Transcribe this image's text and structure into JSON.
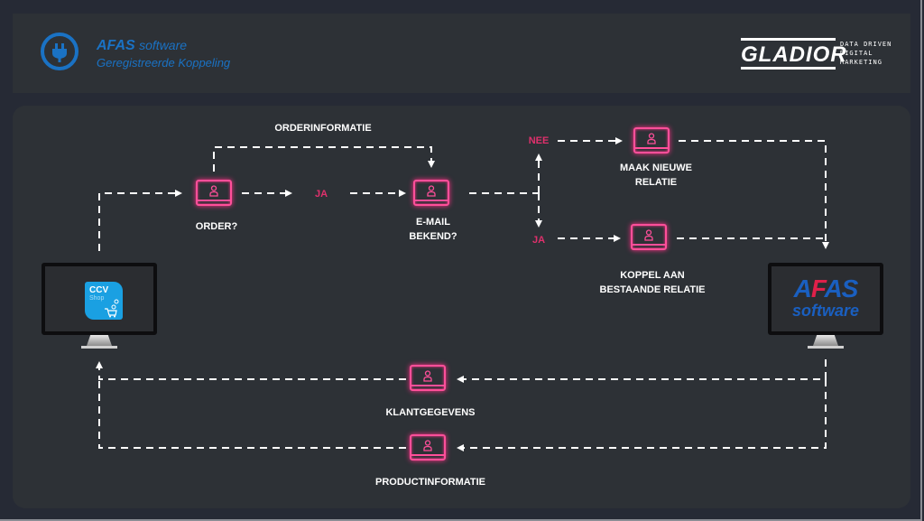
{
  "header": {
    "afas_badge": {
      "brand": "AFAS",
      "brand_suffix": "software",
      "subtitle": "Geregistreerde Koppeling",
      "icon": "plug-icon",
      "color": "#1a72c4"
    },
    "gladior_logo": {
      "name": "GLADIOR",
      "tagline": [
        "DATA DRIVEN",
        "DIGITAL",
        "MARKETING"
      ]
    }
  },
  "systems": {
    "source": {
      "name": "CCV Shop",
      "line1": "CCV",
      "line2": "Shop",
      "color": "#1aa0e2"
    },
    "target": {
      "name": "AFAS software",
      "line1": "AFAS",
      "line2": "software",
      "accent": "#e0204a",
      "color": "#1a5fc0"
    }
  },
  "flow": {
    "orderinformatie": "ORDERINFORMATIE",
    "order_decision": "ORDER?",
    "ja_1": "JA",
    "email_decision_line1": "E-MAIL",
    "email_decision_line2": "BEKEND?",
    "nee": "NEE",
    "ja_2": "JA",
    "new_relation_line1": "MAAK NIEUWE",
    "new_relation_line2": "RELATIE",
    "couple_relation_line1": "KOPPEL AAN",
    "couple_relation_line2": "BESTAANDE RELATIE",
    "klantgegevens": "KLANTGEGEVENS",
    "productinformatie": "PRODUCTINFORMATIE"
  },
  "colors": {
    "node": "#ff4f9a",
    "decision_label": "#e0306c",
    "line": "#ffffff",
    "background": "#2d3136"
  }
}
